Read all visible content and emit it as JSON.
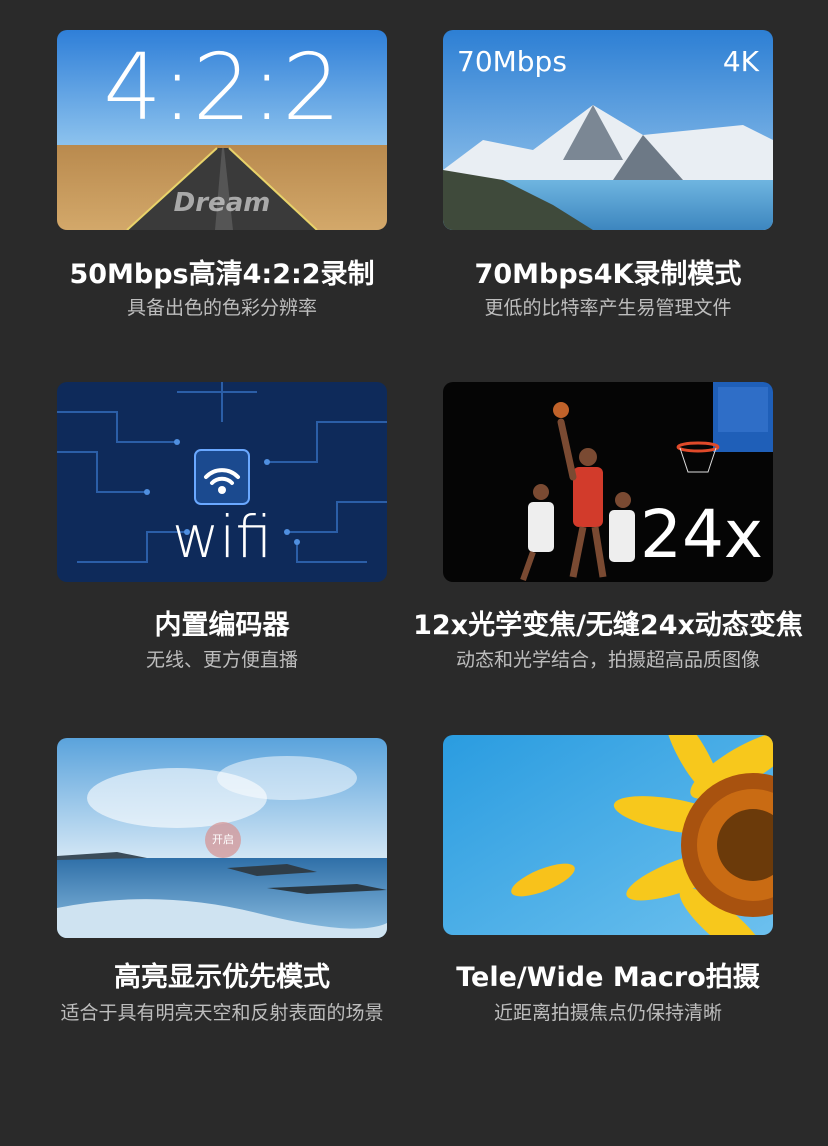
{
  "features": [
    {
      "title": "50Mbps高清4:2:2录制",
      "subtitle": "具备出色的色彩分辨率",
      "overlay_big": "4:2:2",
      "road_text": "Dream"
    },
    {
      "title": "70Mbps4K录制模式",
      "subtitle": "更低的比特率产生易管理文件",
      "overlay_left": "70Mbps",
      "overlay_right": "4K"
    },
    {
      "title": "内置编码器",
      "subtitle": "无线、更方便直播",
      "overlay_big": "wifi"
    },
    {
      "title": "12x光学变焦/无缝24x动态变焦",
      "subtitle": "动态和光学结合，拍摄超高品质图像",
      "overlay_big": "24x"
    },
    {
      "title": "高亮显示优先模式",
      "subtitle": "适合于具有明亮天空和反射表面的场景",
      "overlay_badge": "开启"
    },
    {
      "title": "Tele/Wide Macro拍摄",
      "subtitle": "近距离拍摄焦点仍保持清晰"
    }
  ]
}
